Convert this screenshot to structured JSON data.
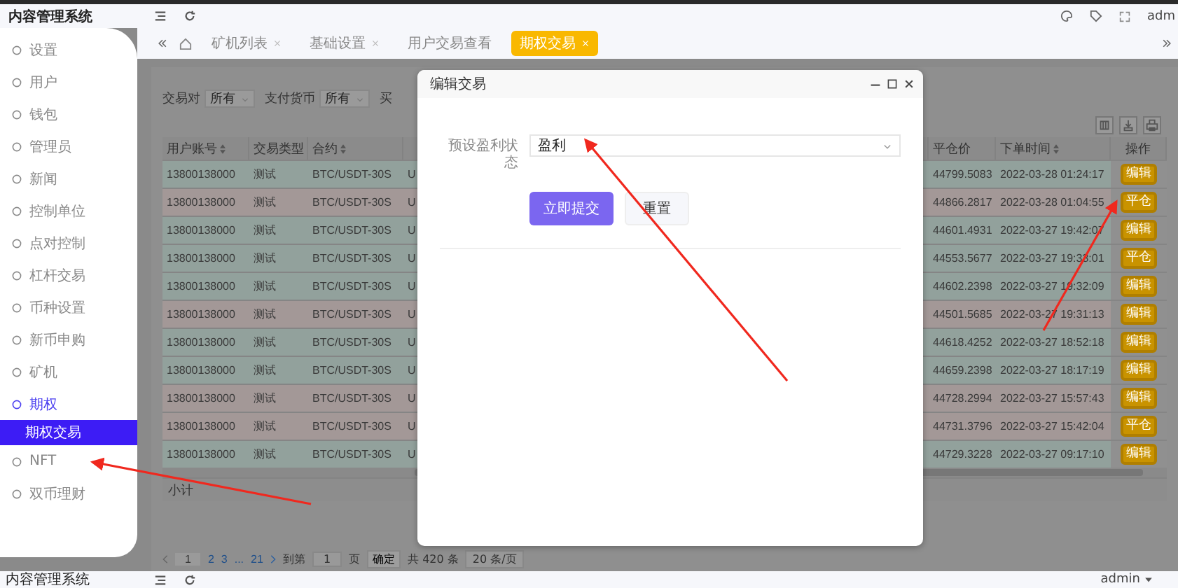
{
  "app_title": "内容管理系统",
  "user": "adm",
  "sidebar": {
    "items": [
      {
        "label": "设置",
        "selected": false
      },
      {
        "label": "用户",
        "selected": false
      },
      {
        "label": "钱包",
        "selected": false
      },
      {
        "label": "管理员",
        "selected": false
      },
      {
        "label": "新闻",
        "selected": false
      },
      {
        "label": "控制单位",
        "selected": false
      },
      {
        "label": "点对控制",
        "selected": false
      },
      {
        "label": "杠杆交易",
        "selected": false
      },
      {
        "label": "币种设置",
        "selected": false
      },
      {
        "label": "新币申购",
        "selected": false
      },
      {
        "label": "矿机",
        "selected": false
      },
      {
        "label": "期权",
        "selected": false,
        "expanded": true,
        "children": [
          {
            "label": "期权交易",
            "selected": true
          }
        ]
      },
      {
        "label": "NFT",
        "selected": false
      },
      {
        "label": "双币理财",
        "selected": false
      }
    ]
  },
  "tabs": [
    {
      "label": "矿机列表",
      "selected": false,
      "closable": true
    },
    {
      "label": "基础设置",
      "selected": false,
      "closable": true
    },
    {
      "label": "用户交易查看",
      "selected": false,
      "closable": false
    },
    {
      "label": "期权交易",
      "selected": true,
      "closable": true
    }
  ],
  "filters": [
    {
      "label": "交易对",
      "value": "所有"
    },
    {
      "label": "支付货币",
      "value": "所有"
    }
  ],
  "filter_cut_label": "买",
  "table": {
    "columns": [
      "用户账号",
      "交易类型",
      "合约",
      "",
      "平仓价",
      "下单时间",
      "操作"
    ],
    "sortable": [
      true,
      false,
      true,
      false,
      false,
      true,
      false
    ],
    "rows": [
      {
        "color": "#92a19c",
        "cells": [
          "13800138000",
          "测试",
          "BTC/USDT-30S",
          "U",
          "44799.5083",
          "2022-03-28 01:24:17"
        ],
        "action": "编辑"
      },
      {
        "color": "#a39897",
        "cells": [
          "13800138000",
          "测试",
          "BTC/USDT-30S",
          "U",
          "44866.2817",
          "2022-03-28 01:04:55"
        ],
        "action": "平仓"
      },
      {
        "color": "#92a19c",
        "cells": [
          "13800138000",
          "测试",
          "BTC/USDT-30S",
          "U",
          "44601.4931",
          "2022-03-27 19:42:07"
        ],
        "action": "编辑"
      },
      {
        "color": "#92a19c",
        "cells": [
          "13800138000",
          "测试",
          "BTC/USDT-30S",
          "U",
          "44553.5677",
          "2022-03-27 19:33:01"
        ],
        "action": "平仓"
      },
      {
        "color": "#92a19c",
        "cells": [
          "13800138000",
          "测试",
          "BTC/USDT-30S",
          "U",
          "44602.2398",
          "2022-03-27 19:32:09"
        ],
        "action": "编辑"
      },
      {
        "color": "#a39897",
        "cells": [
          "13800138000",
          "测试",
          "BTC/USDT-30S",
          "U",
          "44501.5685",
          "2022-03-27 19:31:13"
        ],
        "action": "编辑"
      },
      {
        "color": "#92a19c",
        "cells": [
          "13800138000",
          "测试",
          "BTC/USDT-30S",
          "U",
          "44618.4252",
          "2022-03-27 18:52:18"
        ],
        "action": "编辑"
      },
      {
        "color": "#92a19c",
        "cells": [
          "13800138000",
          "测试",
          "BTC/USDT-30S",
          "U",
          "44659.2398",
          "2022-03-27 18:17:19"
        ],
        "action": "编辑"
      },
      {
        "color": "#a39897",
        "cells": [
          "13800138000",
          "测试",
          "BTC/USDT-30S",
          "U",
          "44728.2994",
          "2022-03-27 15:57:43"
        ],
        "action": "编辑"
      },
      {
        "color": "#a39897",
        "cells": [
          "13800138000",
          "测试",
          "BTC/USDT-30S",
          "U",
          "44731.3796",
          "2022-03-27 15:42:04"
        ],
        "action": "平仓"
      },
      {
        "color": "#92a19c",
        "cells": [
          "13800138000",
          "测试",
          "BTC/USDT-30S",
          "U",
          "44729.3228",
          "2022-03-27 09:17:10"
        ],
        "action": "编辑"
      }
    ],
    "footer": "小计"
  },
  "pagination": {
    "pages": [
      {
        "label": "1",
        "selected": true
      },
      {
        "label": "2",
        "selected": false
      },
      {
        "label": "3",
        "selected": false
      },
      {
        "label": "...",
        "selected": false
      },
      {
        "label": "21",
        "selected": false
      }
    ],
    "goto_label": "到第",
    "goto_value": "1",
    "page_unit": "页",
    "confirm": "确定",
    "total": "共 420 条",
    "page_size": "20 条/页"
  },
  "dialog": {
    "title": "编辑交易",
    "field_label": "预设盈利状态",
    "field_value": "盈利",
    "submit": "立即提交",
    "reset": "重置"
  },
  "footer_bar": {
    "title": "内容管理系统",
    "user": "admin"
  }
}
